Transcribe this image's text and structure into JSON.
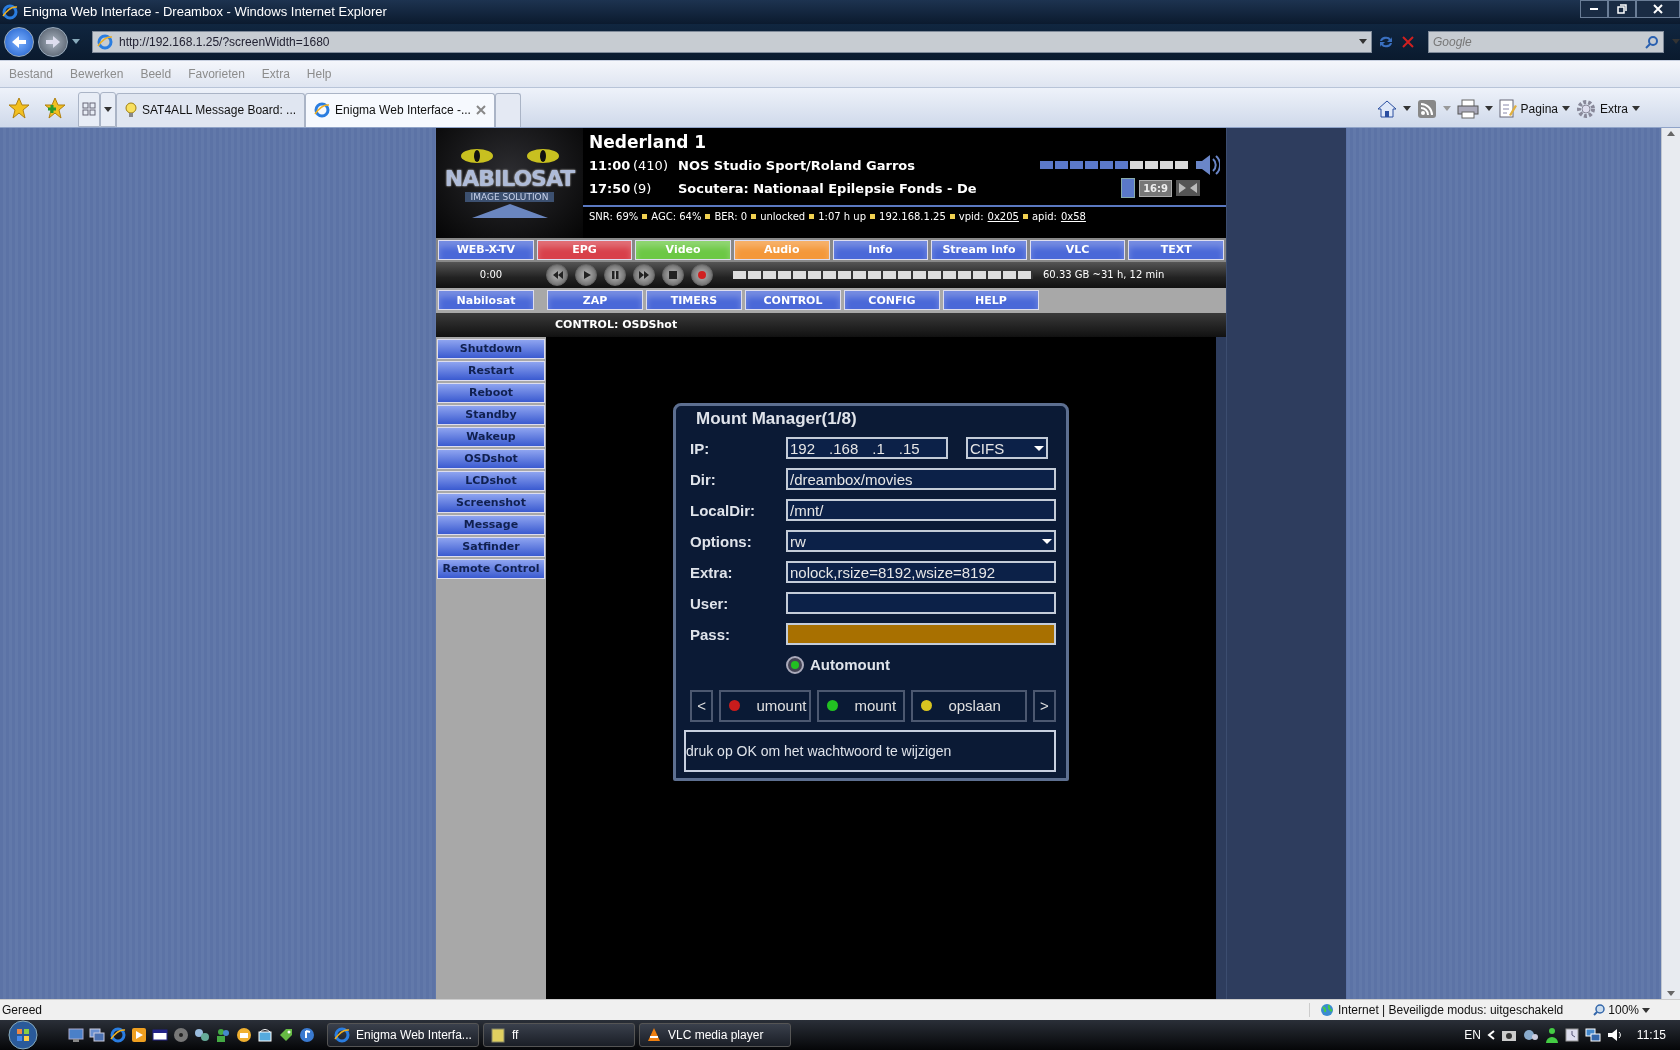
{
  "browser": {
    "title": "Enigma Web Interface - Dreambox - Windows Internet Explorer",
    "address": "http://192.168.1.25/?screenWidth=1680",
    "search_placeholder": "Google",
    "menu": [
      "Bestand",
      "Bewerken",
      "Beeld",
      "Favorieten",
      "Extra",
      "Help"
    ],
    "tabs": [
      {
        "label": "SAT4ALL Message Board: ...",
        "selected": false
      },
      {
        "label": "Enigma Web Interface -...",
        "selected": true
      }
    ],
    "tools": [
      "Pagina",
      "Extra"
    ]
  },
  "header": {
    "logo": {
      "name": "NABILOSAT",
      "tagline": "IMAGE SOLUTION"
    },
    "channel": "Nederland 1",
    "events": [
      {
        "time": "11:00",
        "number": "(410)",
        "title": "NOS Studio Sport/Roland Garros"
      },
      {
        "time": "17:50",
        "number": "(9)",
        "title": "Socutera: Nationaal Epilepsie Fonds - De"
      }
    ],
    "volume": {
      "level": 0.6
    },
    "aspect": "16:9",
    "status": [
      {
        "text": "SNR: 69%"
      },
      {
        "text": "AGC: 64%"
      },
      {
        "text": "BER: 0"
      },
      {
        "text": "unlocked"
      },
      {
        "text": "1:07 h up"
      },
      {
        "text": "192.168.1.25"
      },
      {
        "text": "vpid:",
        "link": "0x205"
      },
      {
        "text": "apid:",
        "link": "0x58"
      }
    ]
  },
  "nav_primary": [
    {
      "label": "WEB-X-TV",
      "color": "#4a68d8"
    },
    {
      "label": "EPG",
      "color": "#d8404a"
    },
    {
      "label": "Video",
      "color": "#6cc844"
    },
    {
      "label": "Audio",
      "color": "#f4983a"
    },
    {
      "label": "Info",
      "color": "#4a68d8"
    },
    {
      "label": "Stream Info",
      "color": "#4a68d8"
    },
    {
      "label": "VLC",
      "color": "#4a68d8"
    },
    {
      "label": "TEXT",
      "color": "#4a68d8"
    }
  ],
  "player": {
    "time": "0:00",
    "progress": {
      "level": 0
    },
    "disk": "60.33 GB ~31 h, 12 min"
  },
  "nav_secondary": {
    "home": "Nabilosat",
    "items": [
      "ZAP",
      "TIMERS",
      "CONTROL",
      "CONFIG",
      "HELP"
    ]
  },
  "breadcrumb": "CONTROL: OSDShot",
  "sidebar": [
    "Shutdown",
    "Restart",
    "Reboot",
    "Standby",
    "Wakeup",
    "OSDshot",
    "LCDshot",
    "Screenshot",
    "Message",
    "Satfinder",
    "Remote Control"
  ],
  "dialog": {
    "title": "Mount Manager(1/8)",
    "fields": [
      {
        "label": "IP:",
        "kind": "ip",
        "parts": [
          "192",
          ".168",
          ".1",
          ".15"
        ],
        "option": "CIFS",
        "focused": false
      },
      {
        "label": "Dir:",
        "kind": "text",
        "value": "/dreambox/movies",
        "focused": false
      },
      {
        "label": "LocalDir:",
        "kind": "text",
        "value": "/mnt/",
        "focused": false
      },
      {
        "label": "Options:",
        "kind": "select",
        "value": "rw",
        "focused": false
      },
      {
        "label": "Extra:",
        "kind": "text",
        "value": "nolock,rsize=8192,wsize=8192",
        "focused": false
      },
      {
        "label": "User:",
        "kind": "text",
        "focused": false
      },
      {
        "label": "Pass:",
        "kind": "text",
        "focused": true
      }
    ],
    "automount": {
      "label": "Automount",
      "checked": true
    },
    "buttons": [
      {
        "kind": "arrow",
        "label": "<"
      },
      {
        "kind": "color",
        "label": "umount",
        "color": "#c81c1c"
      },
      {
        "kind": "color",
        "label": "mount",
        "color": "#22c022"
      },
      {
        "kind": "color",
        "label": "opslaan",
        "color": "#d8c420"
      },
      {
        "kind": "arrow",
        "label": ">"
      }
    ],
    "message": "druk op OK om het wachtwoord te wijzigen"
  },
  "status_bar": {
    "text": "Gereed",
    "zone": "Internet | Beveiligde modus: uitgeschakeld",
    "zoom": "100%"
  },
  "taskbar": {
    "tasks": [
      "Enigma Web Interfa...",
      "ff",
      "VLC media player"
    ],
    "language": "EN",
    "clock": "11:15"
  }
}
